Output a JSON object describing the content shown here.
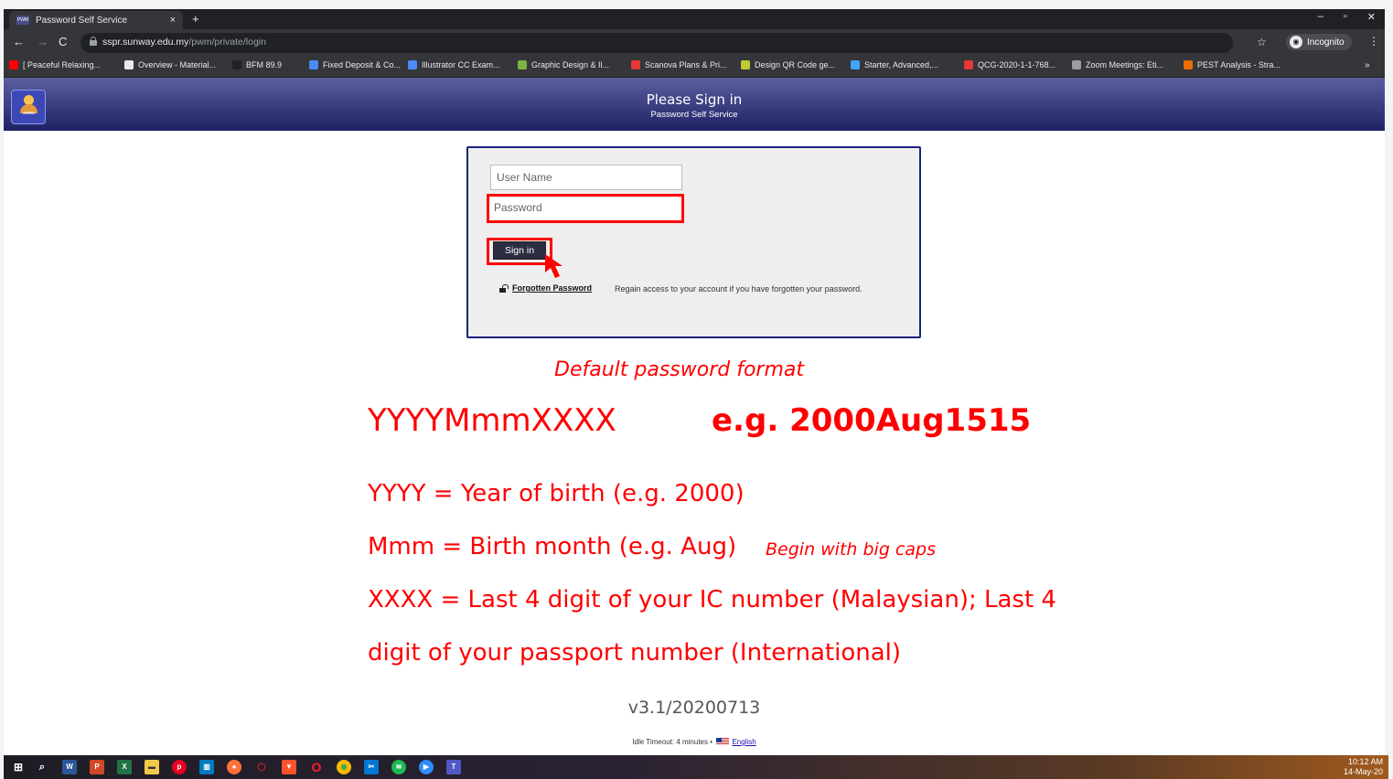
{
  "browser": {
    "tab_title": "Password Self Service",
    "tab_favicon": "PWM",
    "tab_close": "×",
    "new_tab": "+",
    "window_controls": [
      "–",
      "▫",
      "✕"
    ],
    "url_host": "sspr.sunway.edu.my",
    "url_path": "/pwm/private/login",
    "incognito_label": "Incognito",
    "bookmarks": [
      {
        "label": "[ Peaceful Relaxing...",
        "color": "#ff0000"
      },
      {
        "label": "Overview - Material...",
        "color": "#e8eaed"
      },
      {
        "label": "BFM 89.9",
        "color": "#222222"
      },
      {
        "label": "Fixed Deposit & Co...",
        "color": "#4c8bf5"
      },
      {
        "label": "Illustrator CC Exam...",
        "color": "#4c8bf5"
      },
      {
        "label": "Graphic Design & Il...",
        "color": "#7cb342"
      },
      {
        "label": "Scanova Plans & Pri...",
        "color": "#e53935"
      },
      {
        "label": "Design QR Code ge...",
        "color": "#c0ca33"
      },
      {
        "label": "Starter, Advanced,...",
        "color": "#42a5f5"
      },
      {
        "label": "QCG-2020-1-1-768...",
        "color": "#e53935"
      },
      {
        "label": "Zoom Meetings: Eti...",
        "color": "#9e9e9e"
      },
      {
        "label": "PEST Analysis - Stra...",
        "color": "#ef6c00"
      }
    ],
    "bookmarks_more": "»"
  },
  "header": {
    "title": "Please Sign in",
    "subtitle": "Password Self Service",
    "logo_stars": "******"
  },
  "login": {
    "username_placeholder": "User Name",
    "password_placeholder": "Password",
    "signin_label": "Sign in",
    "forgot_label": "Forgotten Password",
    "forgot_description": "Regain access to your account if you have forgotten your password."
  },
  "annotation": {
    "heading": "Default password format",
    "format": "YYYYMmmXXXX",
    "example": "e.g. 2000Aug1515",
    "line_year": "YYYY = Year of birth (e.g. 2000)",
    "line_month": "Mmm = Birth month (e.g. Aug)",
    "line_month_note": "Begin with big caps",
    "line_digits_1": "XXXX = Last 4 digit of your IC number (Malaysian); Last 4",
    "line_digits_2": "digit of your passport number (International)"
  },
  "footer": {
    "version": "v3.1/20200713",
    "idle_timeout": "Idle Timeout: 4 minutes  •",
    "language": "English"
  },
  "taskbar": {
    "time": "10:12 AM",
    "date": "14-May-20"
  },
  "colors": {
    "accent_red": "#ff0000",
    "header_dark": "#1e2266",
    "panel_border": "#1a237e"
  }
}
